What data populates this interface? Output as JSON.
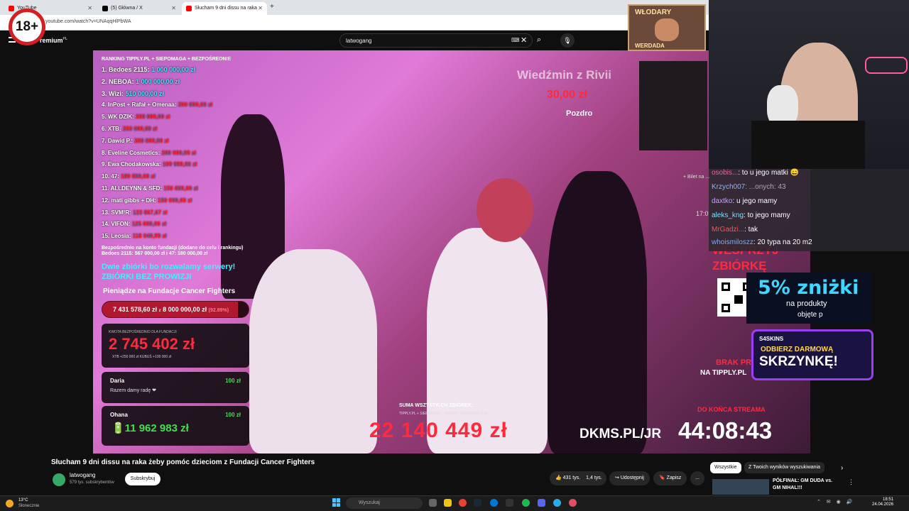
{
  "browser": {
    "tabs": [
      {
        "label": "YouTube",
        "color": "#ff0000",
        "active": false
      },
      {
        "label": "(5) Główna / X",
        "color": "#000000",
        "active": false
      },
      {
        "label": "Słucham 9 dni dissu na raka",
        "color": "#ff0000",
        "active": true
      }
    ],
    "new_tab": "+",
    "url": "youtube.com/watch?v=UNAqqHlPbWA"
  },
  "age_badge": "18+",
  "youtube": {
    "logo": "Premium",
    "logo_sup": "PL",
    "search_value": "latwogang"
  },
  "overlay": {
    "ranking_header": "RANKING TIPPLY.PL + SIEPOMAGA + BEZPOŚREDNIE",
    "ranking": [
      {
        "name": "1. Bedoes 2115:",
        "amount": "1 000 000,00 zł",
        "color": "cyan"
      },
      {
        "name": "2. NEBOA:",
        "amount": "1 000 000,00 zł",
        "color": "cyan"
      },
      {
        "name": "3. Wizi:",
        "amount": "510 000,00 zł",
        "color": "cyan"
      },
      {
        "name": "4. InPost + Rafał + Omenaa:",
        "amount": "300 000,00 zł",
        "color": "red"
      },
      {
        "name": "5. WK DZIK:",
        "amount": "300 000,00 zł",
        "color": "red"
      },
      {
        "name": "6. XTB:",
        "amount": "250 000,00 zł",
        "color": "red"
      },
      {
        "name": "7. Dawid P.:",
        "amount": "200 000,00 zł",
        "color": "red"
      },
      {
        "name": "8. Eveline Cosmetics:",
        "amount": "200 000,00 zł",
        "color": "red"
      },
      {
        "name": "9. Ewa Chodakowska:",
        "amount": "199 999,00 zł",
        "color": "red"
      },
      {
        "name": "10. 47:",
        "amount": "180 000,00 zł",
        "color": "red"
      },
      {
        "name": "11. ALLDEYNN & SFD:",
        "amount": "150 000,00 zł",
        "color": "red"
      },
      {
        "name": "12. mati gibbs + DH:",
        "amount": "150 000,00 zł",
        "color": "red"
      },
      {
        "name": "13. SVM!R:",
        "amount": "123 867,67 zł",
        "color": "red"
      },
      {
        "name": "14. VIFON:",
        "amount": "125 000,00 zł",
        "color": "red"
      },
      {
        "name": "15. Leosia:",
        "amount": "118 040,99 zł",
        "color": "red"
      }
    ],
    "direct_note_1": "Bezpośrednio na konto fundacji (dodane do celu i rankingu)",
    "direct_note_2": "Bedoes 2115: 567 000,00 zł i 47: 180 000,00 zł",
    "servers_1": "Dwie zbiórki bo rozwalamy serwery!",
    "servers_2": "ZBIÓRKI BEZ PROWIZJI",
    "foundation": "Pieniądze na Fundacje Cancer Fighters",
    "progress_raised": "7 431 578,60 zł",
    "progress_sep": "z",
    "progress_goal": "8 000 000,00 zł",
    "progress_pct_label": "(92.89%)",
    "progress_fraction": 0.9289,
    "direct_box": {
      "title": "KWOTA BEZPOŚREDNIO DLA FUNDACJI",
      "amount": "2 745 402 zł",
      "sub": "XTB +250 000 zł        KUBUŚ +100 000 zł"
    },
    "donors": [
      {
        "name": "Daria",
        "amount": "100 zł",
        "message": "Razem damy radę ❤"
      },
      {
        "name": "Ohana",
        "amount": "100 zł",
        "total": "🔋11 962 983 zł"
      }
    ],
    "alert": {
      "title": "Wiedźmin z Rivii",
      "amount": "30,00 zł",
      "message": "Pozdro"
    },
    "sum_title": "SUMA WSZYSTKICH ZBIÓREK:",
    "sum_sub": "TIPPLY.PL + SIEPOMAGA + WPŁATY BEZPOŚREDNIE",
    "sum_value": "22 140 449 zł",
    "dkms": "DKMS.PL/JR",
    "countdown_label": "DO KOŃCA STREAMA",
    "countdown": "44:08:43",
    "support_1": "WESPRZYJ",
    "support_2": "ZBIÓRKĘ",
    "brak_1": "BRAK PR",
    "brak_2": "NA TIPPLY.PL"
  },
  "promo": {
    "discount": "5% zniżki",
    "line1": "na produkty",
    "line2": "objęte p",
    "skins_logo": "S4SKINS",
    "skins_1": "ODBIERZ DARMOWĄ",
    "skins_2": "SKRZYNKĘ!"
  },
  "banner": {
    "top": "WŁODARY",
    "bottom": "WERDADA"
  },
  "chat": [
    {
      "user": "osobis...",
      "text": ": to u jego matki 😄",
      "color": "#ff5aa0"
    },
    {
      "user": "Krzych007",
      "text": ": ...onych: 43",
      "color": "#8ab4ff"
    },
    {
      "user": "daxtko",
      "text": ": u jego mamy",
      "color": "#c8a0ff"
    },
    {
      "user": "aleks_kng",
      "text": ": to jego mamy",
      "color": "#7ee0ff"
    },
    {
      "user": "MrGadzi...",
      "text": ": tak",
      "color": "#ff5050"
    },
    {
      "user": "whoismiloszz",
      "text": ": 20 typa na 20 m2",
      "color": "#7ea8ff"
    }
  ],
  "chat_extra": [
    "+ Bilet na ...",
    "17:0"
  ],
  "video": {
    "title": "Słucham 9 dni dissu na raka żeby pomóc dzieciom z Fundacji Cancer Fighters",
    "channel": "latwogang",
    "subscribers": "579 tys. subskrybentów",
    "subscribe": "Subskrybuj",
    "likes": "431 tys.",
    "dislikes": "1,4 tys.",
    "share": "Udostępnij",
    "save": "Zapisz",
    "more": "..."
  },
  "recommend": {
    "chips": [
      "Wszystkie",
      "Z Twoich wyników wyszukiwania"
    ],
    "title": "PÓŁFINAŁ: GM DUDA vs. GM NIHAL!!!"
  },
  "taskbar": {
    "weather_temp": "13°C",
    "weather_desc": "Słonecznie",
    "search_placeholder": "Wyszukaj",
    "time": "18:51",
    "date": "24.04.2026"
  }
}
